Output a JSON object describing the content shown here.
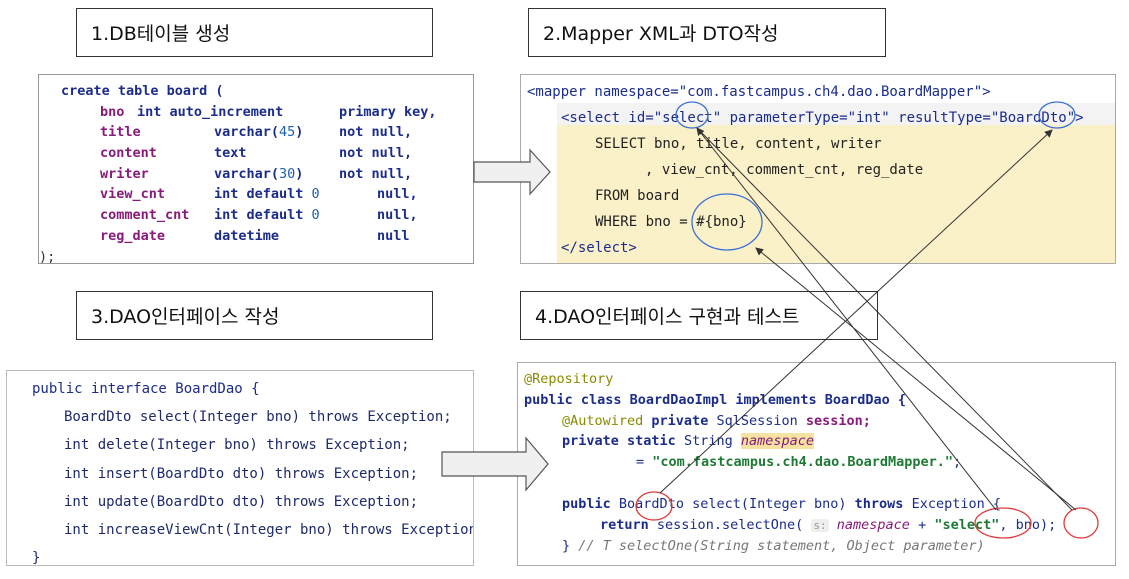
{
  "titles": {
    "t1": "1.DB테이블 생성",
    "t2": "2.Mapper XML과 DTO작성",
    "t3": "3.DAO인터페이스 작성",
    "t4": "4.DAO인터페이스 구현과 테스트"
  },
  "sql": {
    "l1": "create table board (",
    "rows": [
      {
        "name": "bno",
        "type": "int auto_increment",
        "constraint": "primary key,"
      },
      {
        "name": "title",
        "type": "varchar(45)",
        "constraint": "not null,"
      },
      {
        "name": "content",
        "type": "text",
        "constraint": "not null,"
      },
      {
        "name": "writer",
        "type": "varchar(30)",
        "constraint": "not null,"
      },
      {
        "name": "view_cnt",
        "type": "int default 0",
        "constraint": "null,"
      },
      {
        "name": "comment_cnt",
        "type": "int default 0",
        "constraint": "null,"
      },
      {
        "name": "reg_date",
        "type": "datetime",
        "constraint": "null"
      }
    ],
    "end": ");"
  },
  "xml": {
    "l1": "<mapper namespace=\"com.fastcampus.ch4.dao.BoardMapper\">",
    "l2": "<select id=\"select\" parameterType=\"int\" resultType=\"BoardDto\">",
    "l3": "SELECT bno, title, content, writer",
    "l4": ", view_cnt, comment_cnt, reg_date",
    "l5": "FROM board",
    "l6": "WHERE bno = #{bno}",
    "l7": "</select>"
  },
  "dao": {
    "l1": "public interface BoardDao {",
    "methods": [
      "BoardDto select(Integer bno) throws Exception;",
      "int delete(Integer bno) throws Exception;",
      "int insert(BoardDto dto) throws Exception;",
      "int update(BoardDto dto) throws Exception;",
      "int increaseViewCnt(Integer bno) throws Exception;"
    ],
    "end": "}"
  },
  "impl": {
    "l1": "@Repository",
    "l2": "public class BoardDaoImpl implements BoardDao {",
    "l3_ann": "@Autowired",
    "l3_kw": "private",
    "l3_type": "SqlSession",
    "l3_field": "session;",
    "l4_kw": "private static",
    "l4_type": "String",
    "l4_field": "namespace",
    "l5_eq": "=",
    "l5_str": "\"com.fastcampus.ch4.dao.BoardMapper.\"",
    "l5_end": ";",
    "l6_kw": "public",
    "l6_rest": "BoardDto select(Integer bno)",
    "l6_throws": "throws",
    "l6_end": "Exception {",
    "l7_kw": "return",
    "l7_call": "session.selectOne(",
    "l7_hint": "s:",
    "l7_ns": "namespace",
    "l7_plus": "+",
    "l7_str": "\"select\"",
    "l7_end": ", bno);",
    "l8_brace": "}",
    "l8_cmt": "// T selectOne(String statement, Object parameter)"
  }
}
